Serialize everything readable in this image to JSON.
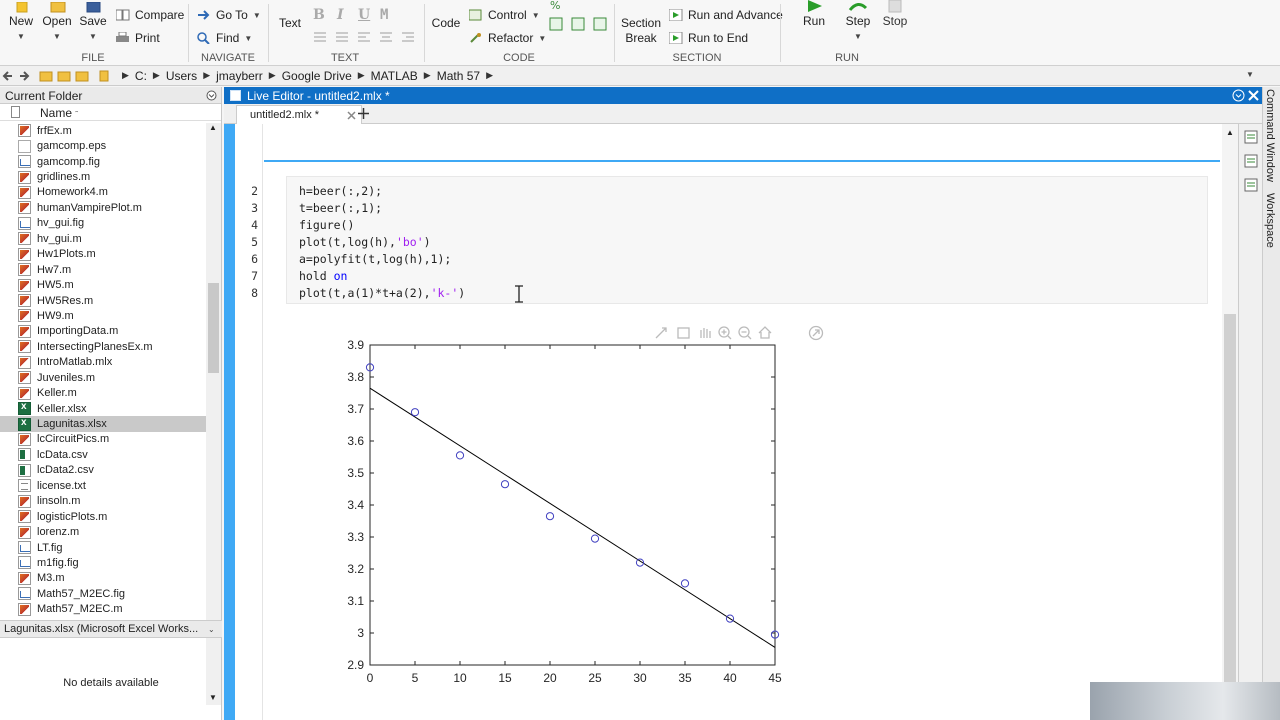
{
  "ribbon": {
    "file": {
      "new": "New",
      "open": "Open",
      "save": "Save",
      "compare": "Compare",
      "print": "Print",
      "group": "FILE"
    },
    "navigate": {
      "goto": "Go To",
      "find": "Find",
      "group": "NAVIGATE"
    },
    "text": {
      "text": "Text",
      "bold": "B",
      "italic": "I",
      "underline": "U",
      "mono": "M",
      "group": "TEXT"
    },
    "code": {
      "code": "Code",
      "control": "Control",
      "refactor": "Refactor",
      "group": "CODE"
    },
    "section": {
      "section_break_1": "Section",
      "section_break_2": "Break",
      "run_advance": "Run and Advance",
      "run_to_end": "Run to End",
      "group": "SECTION"
    },
    "run": {
      "run": "Run",
      "step": "Step",
      "stop": "Stop",
      "group": "RUN"
    }
  },
  "address": {
    "drive": "C:",
    "crumbs": [
      "Users",
      "jmayberr",
      "Google Drive",
      "MATLAB",
      "Math 57"
    ]
  },
  "left_panel": {
    "title": "Current Folder",
    "name_col": "Name",
    "files": [
      {
        "name": "frfEx.m",
        "type": "m"
      },
      {
        "name": "gamcomp.eps",
        "type": "eps"
      },
      {
        "name": "gamcomp.fig",
        "type": "fig"
      },
      {
        "name": "gridlines.m",
        "type": "m"
      },
      {
        "name": "Homework4.m",
        "type": "m"
      },
      {
        "name": "humanVampirePlot.m",
        "type": "m"
      },
      {
        "name": "hv_gui.fig",
        "type": "fig"
      },
      {
        "name": "hv_gui.m",
        "type": "m"
      },
      {
        "name": "Hw1Plots.m",
        "type": "m"
      },
      {
        "name": "Hw7.m",
        "type": "m"
      },
      {
        "name": "HW5.m",
        "type": "m"
      },
      {
        "name": "HW5Res.m",
        "type": "m"
      },
      {
        "name": "HW9.m",
        "type": "m"
      },
      {
        "name": "ImportingData.m",
        "type": "m"
      },
      {
        "name": "IntersectingPlanesEx.m",
        "type": "m"
      },
      {
        "name": "IntroMatlab.mlx",
        "type": "mlx"
      },
      {
        "name": "Juveniles.m",
        "type": "m"
      },
      {
        "name": "Keller.m",
        "type": "m"
      },
      {
        "name": "Keller.xlsx",
        "type": "xls"
      },
      {
        "name": "Lagunitas.xlsx",
        "type": "xls",
        "selected": true
      },
      {
        "name": "lcCircuitPics.m",
        "type": "m"
      },
      {
        "name": "lcData.csv",
        "type": "csv"
      },
      {
        "name": "lcData2.csv",
        "type": "csv"
      },
      {
        "name": "license.txt",
        "type": "txt"
      },
      {
        "name": "linsoln.m",
        "type": "m"
      },
      {
        "name": "logisticPlots.m",
        "type": "m"
      },
      {
        "name": "lorenz.m",
        "type": "m"
      },
      {
        "name": "LT.fig",
        "type": "fig"
      },
      {
        "name": "m1fig.fig",
        "type": "fig"
      },
      {
        "name": "M3.m",
        "type": "m"
      },
      {
        "name": "Math57_M2EC.fig",
        "type": "fig"
      },
      {
        "name": "Math57_M2EC.m",
        "type": "m"
      }
    ],
    "details_title": "Lagunitas.xlsx  (Microsoft Excel Works...",
    "details_body": "No details available"
  },
  "editor": {
    "title": "Live Editor - untitled2.mlx *",
    "tab": "untitled2.mlx *",
    "lines": [
      {
        "n": "2",
        "code": "h=beer(:,2);"
      },
      {
        "n": "3",
        "code": "t=beer(:,1);"
      },
      {
        "n": "4",
        "code": "figure()"
      },
      {
        "n": "5",
        "pre": "plot(t,log(h),",
        "str": "'bo'",
        "post": ")"
      },
      {
        "n": "6",
        "code": "a=polyfit(t,log(h),1);"
      },
      {
        "n": "7",
        "pre": "hold ",
        "kw": "on",
        "post": ""
      },
      {
        "n": "8",
        "pre": "plot(t,a(1)*t+a(2),",
        "str": "'k-'",
        "post": ")"
      }
    ]
  },
  "side_tabs": {
    "command": "Command Window",
    "workspace": "Workspace"
  },
  "colors": {
    "accent": "#0f6fc6",
    "section_bar": "#3fa9f5",
    "marker": "#4040c0"
  },
  "chart_data": {
    "type": "scatter",
    "x": [
      0,
      5,
      10,
      15,
      20,
      25,
      30,
      35,
      40,
      45
    ],
    "series": [
      {
        "values": [
          3.83,
          3.69,
          3.555,
          3.465,
          3.365,
          3.295,
          3.22,
          3.155,
          3.045,
          2.995
        ],
        "marker": "circle",
        "color": "#4040c0"
      }
    ],
    "fit_line": {
      "x": [
        0,
        45
      ],
      "y": [
        3.765,
        2.955
      ],
      "color": "#000000"
    },
    "xlim": [
      0,
      45
    ],
    "ylim": [
      2.9,
      3.9
    ],
    "xticks": [
      0,
      5,
      10,
      15,
      20,
      25,
      30,
      35,
      40,
      45
    ],
    "yticks": [
      2.9,
      3,
      3.1,
      3.2,
      3.3,
      3.4,
      3.5,
      3.6,
      3.7,
      3.8,
      3.9
    ],
    "yticklabels": [
      "2.9",
      "3",
      "3.1",
      "3.2",
      "3.3",
      "3.4",
      "3.5",
      "3.6",
      "3.7",
      "3.8",
      "3.9"
    ],
    "grid": false
  }
}
